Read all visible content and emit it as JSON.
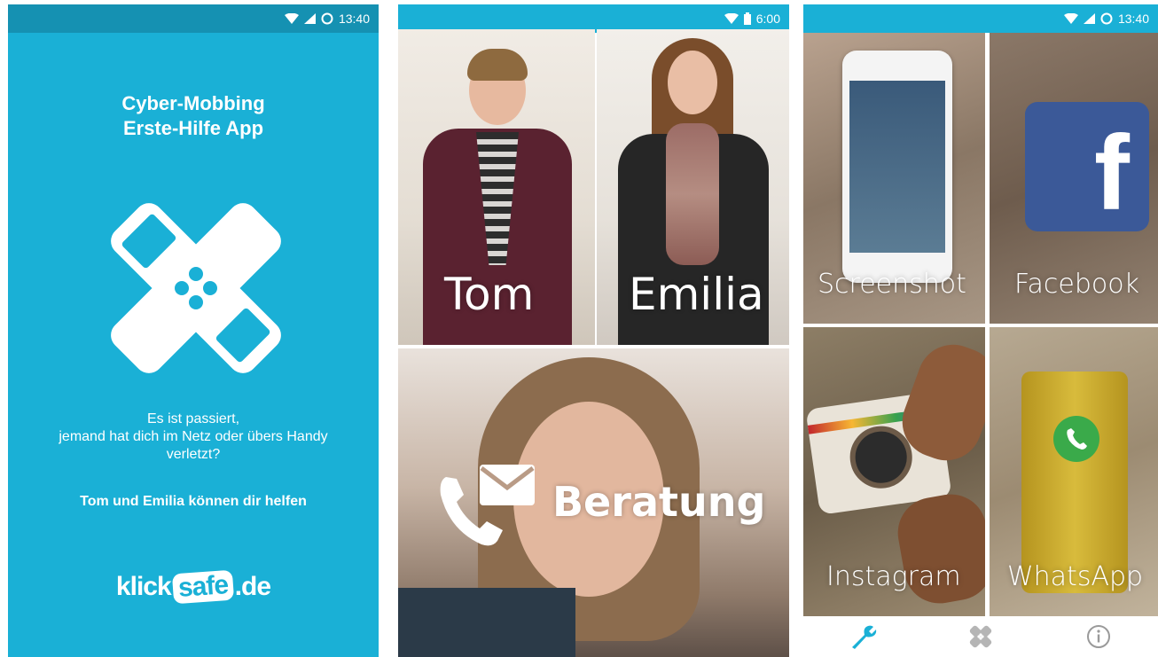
{
  "screen1": {
    "status": {
      "time": "13:40"
    },
    "title_line1": "Cyber-Mobbing",
    "title_line2": "Erste-Hilfe App",
    "intro_line1": "Es ist passiert,",
    "intro_line2": "jemand hat dich im Netz oder übers Handy",
    "intro_line3": "verletzt?",
    "help_text": "Tom und Emilia können dir helfen",
    "brand": {
      "part1": "klick",
      "part2": "safe",
      "part3": ".de"
    },
    "colors": {
      "background": "#1ab0d6",
      "statusbar": "#1591b2"
    }
  },
  "screen2": {
    "status": {
      "time": "6:00"
    },
    "tiles": {
      "tom": "Tom",
      "emilia": "Emilia",
      "beratung": "Beratung"
    }
  },
  "screen3": {
    "status": {
      "time": "13:40"
    },
    "tiles": {
      "screenshot": "Screenshot",
      "facebook": "Facebook",
      "instagram": "Instagram",
      "whatsapp": "WhatsApp"
    },
    "tabs": [
      {
        "icon": "wrench-icon",
        "active": true
      },
      {
        "icon": "bandage-icon",
        "active": false
      },
      {
        "icon": "info-icon",
        "active": false
      }
    ],
    "colors": {
      "accent": "#1ab0d6"
    }
  }
}
